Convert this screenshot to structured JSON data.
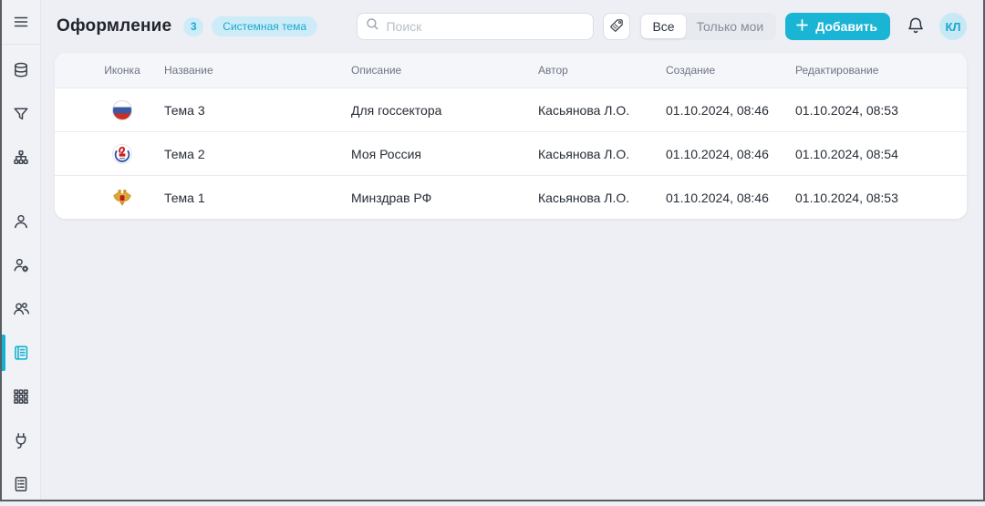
{
  "app": {
    "accent_color": "#1ab4d4",
    "chip_bg_color": "#cdecf8",
    "chip_text_color": "#1ba9cf"
  },
  "header": {
    "title": "Оформление",
    "count_badge": "3",
    "theme_chip": "Системная тема",
    "search_placeholder": "Поиск",
    "filter_all": "Все",
    "filter_mine": "Только мои",
    "add_button": "Добавить",
    "avatar_initials": "КЛ"
  },
  "sidebar": {
    "menu_icon": "hamburger-icon",
    "primary": [
      "database-icon",
      "filter-icon",
      "hierarchy-icon"
    ],
    "secondary": [
      "user-icon",
      "user-settings-icon",
      "users-group-icon",
      "journal-icon",
      "apps-grid-icon",
      "plug-icon",
      "document-list-icon"
    ],
    "active": "journal-icon"
  },
  "table": {
    "columns": [
      "Иконка",
      "Название",
      "Описание",
      "Автор",
      "Создание",
      "Редактирование"
    ],
    "rows": [
      {
        "icon": "russia-flag-icon",
        "name": "Тема 3",
        "description": "Для госсектора",
        "author": "Касьянова Л.О.",
        "created": "01.10.2024, 08:46",
        "edited": "01.10.2024, 08:53"
      },
      {
        "icon": "moya-rossiya-icon",
        "name": "Тема 2",
        "description": "Моя Россия",
        "author": "Касьянова Л.О.",
        "created": "01.10.2024, 08:46",
        "edited": "01.10.2024, 08:54"
      },
      {
        "icon": "minzdrav-emblem-icon",
        "name": "Тема 1",
        "description": "Минздрав РФ",
        "author": "Касьянова Л.О.",
        "created": "01.10.2024, 08:46",
        "edited": "01.10.2024, 08:53"
      }
    ]
  }
}
